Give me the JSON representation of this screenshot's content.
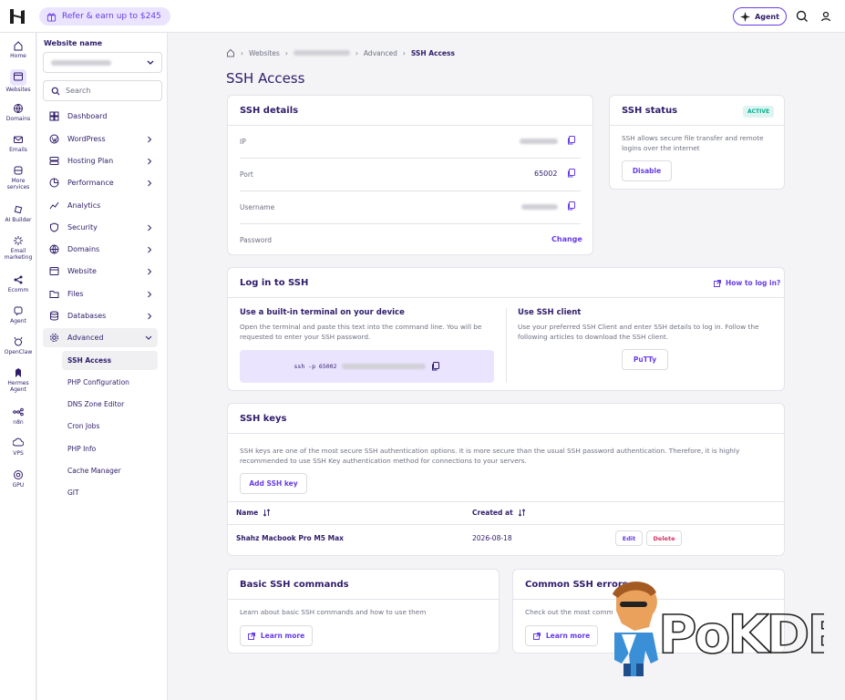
{
  "topbar": {
    "refer_label": "Refer & earn up to $245",
    "agent_label": "Agent"
  },
  "rail": [
    {
      "label": "Home",
      "icon": "home-icon"
    },
    {
      "label": "Websites",
      "icon": "websites-icon",
      "selected": true
    },
    {
      "label": "Domains",
      "icon": "globe-icon"
    },
    {
      "label": "Emails",
      "icon": "mail-icon"
    },
    {
      "label": "More services",
      "icon": "services-icon"
    },
    {
      "label": "AI Builder",
      "icon": "ai-builder-icon"
    },
    {
      "label": "Email marketing",
      "icon": "email-marketing-icon"
    },
    {
      "label": "Ecomm",
      "icon": "ecomm-icon"
    },
    {
      "label": "Agent",
      "icon": "agent-icon"
    },
    {
      "label": "OpenClaw",
      "icon": "openclaw-icon"
    },
    {
      "label": "Hermes Agent",
      "icon": "hermes-icon"
    },
    {
      "label": "n8n",
      "icon": "n8n-icon"
    },
    {
      "label": "VPS",
      "icon": "vps-icon"
    },
    {
      "label": "GPU",
      "icon": "gpu-icon"
    }
  ],
  "sidebar": {
    "website_label": "Website name",
    "search_placeholder": "Search",
    "items": [
      {
        "label": "Dashboard",
        "icon": "dashboard-icon"
      },
      {
        "label": "WordPress",
        "icon": "wordpress-icon",
        "chevron": true
      },
      {
        "label": "Hosting Plan",
        "icon": "hosting-plan-icon",
        "chevron": true
      },
      {
        "label": "Performance",
        "icon": "performance-icon",
        "chevron": true
      },
      {
        "label": "Analytics",
        "icon": "analytics-icon"
      },
      {
        "label": "Security",
        "icon": "security-icon",
        "chevron": true
      },
      {
        "label": "Domains",
        "icon": "domains-icon",
        "chevron": true
      },
      {
        "label": "Website",
        "icon": "website-icon",
        "chevron": true
      },
      {
        "label": "Files",
        "icon": "files-icon",
        "chevron": true
      },
      {
        "label": "Databases",
        "icon": "databases-icon",
        "chevron": true
      },
      {
        "label": "Advanced",
        "icon": "advanced-icon",
        "chevron": true,
        "expanded": true
      }
    ],
    "sub_items": [
      "SSH Access",
      "PHP Configuration",
      "DNS Zone Editor",
      "Cron Jobs",
      "PHP Info",
      "Cache Manager",
      "GIT"
    ]
  },
  "breadcrumb": {
    "websites": "Websites",
    "advanced": "Advanced",
    "current": "SSH Access"
  },
  "page_title": "SSH Access",
  "ssh_details": {
    "title": "SSH details",
    "ip_label": "IP",
    "port_label": "Port",
    "port_value": "65002",
    "username_label": "Username",
    "password_label": "Password",
    "change_label": "Change"
  },
  "ssh_status": {
    "title": "SSH status",
    "badge": "ACTIVE",
    "description": "SSH allows secure file transfer and remote logins over the internet",
    "disable_label": "Disable"
  },
  "login": {
    "title": "Log in to SSH",
    "how_label": "How to log in?",
    "terminal_title": "Use a built-in terminal on your device",
    "terminal_desc": "Open the terminal and paste this text into the command line. You will be requested to enter your SSH password.",
    "command_prefix": "ssh -p 65002",
    "client_title": "Use SSH client",
    "client_desc": "Use your preferred SSH Client and enter SSH details to log in. Follow the following articles to download the SSH client.",
    "putty_label": "PuTTy"
  },
  "ssh_keys": {
    "title": "SSH keys",
    "description": "SSH keys are one of the most secure SSH authentication options. It is more secure than the usual SSH password authentication. Therefore, it is highly recommended to use SSH Key authentication method for connections to your servers.",
    "add_label": "Add SSH key",
    "col_name": "Name",
    "col_created": "Created at",
    "rows": [
      {
        "name": "Shahz Macbook Pro M5 Max",
        "created": "2026-08-18",
        "edit": "Edit",
        "delete": "Delete"
      }
    ]
  },
  "basic_commands": {
    "title": "Basic SSH commands",
    "description": "Learn about basic SSH commands and how to use them",
    "learn_label": "Learn more"
  },
  "common_errors": {
    "title": "Common SSH errors",
    "description": "Check out the most comm",
    "learn_label": "Learn more"
  },
  "watermark": {
    "text": "PoKDE.NET"
  },
  "colors": {
    "accent": "#673de6",
    "text": "#2f1c6a",
    "muted": "#6d7081",
    "active_badge": "#00b090"
  }
}
